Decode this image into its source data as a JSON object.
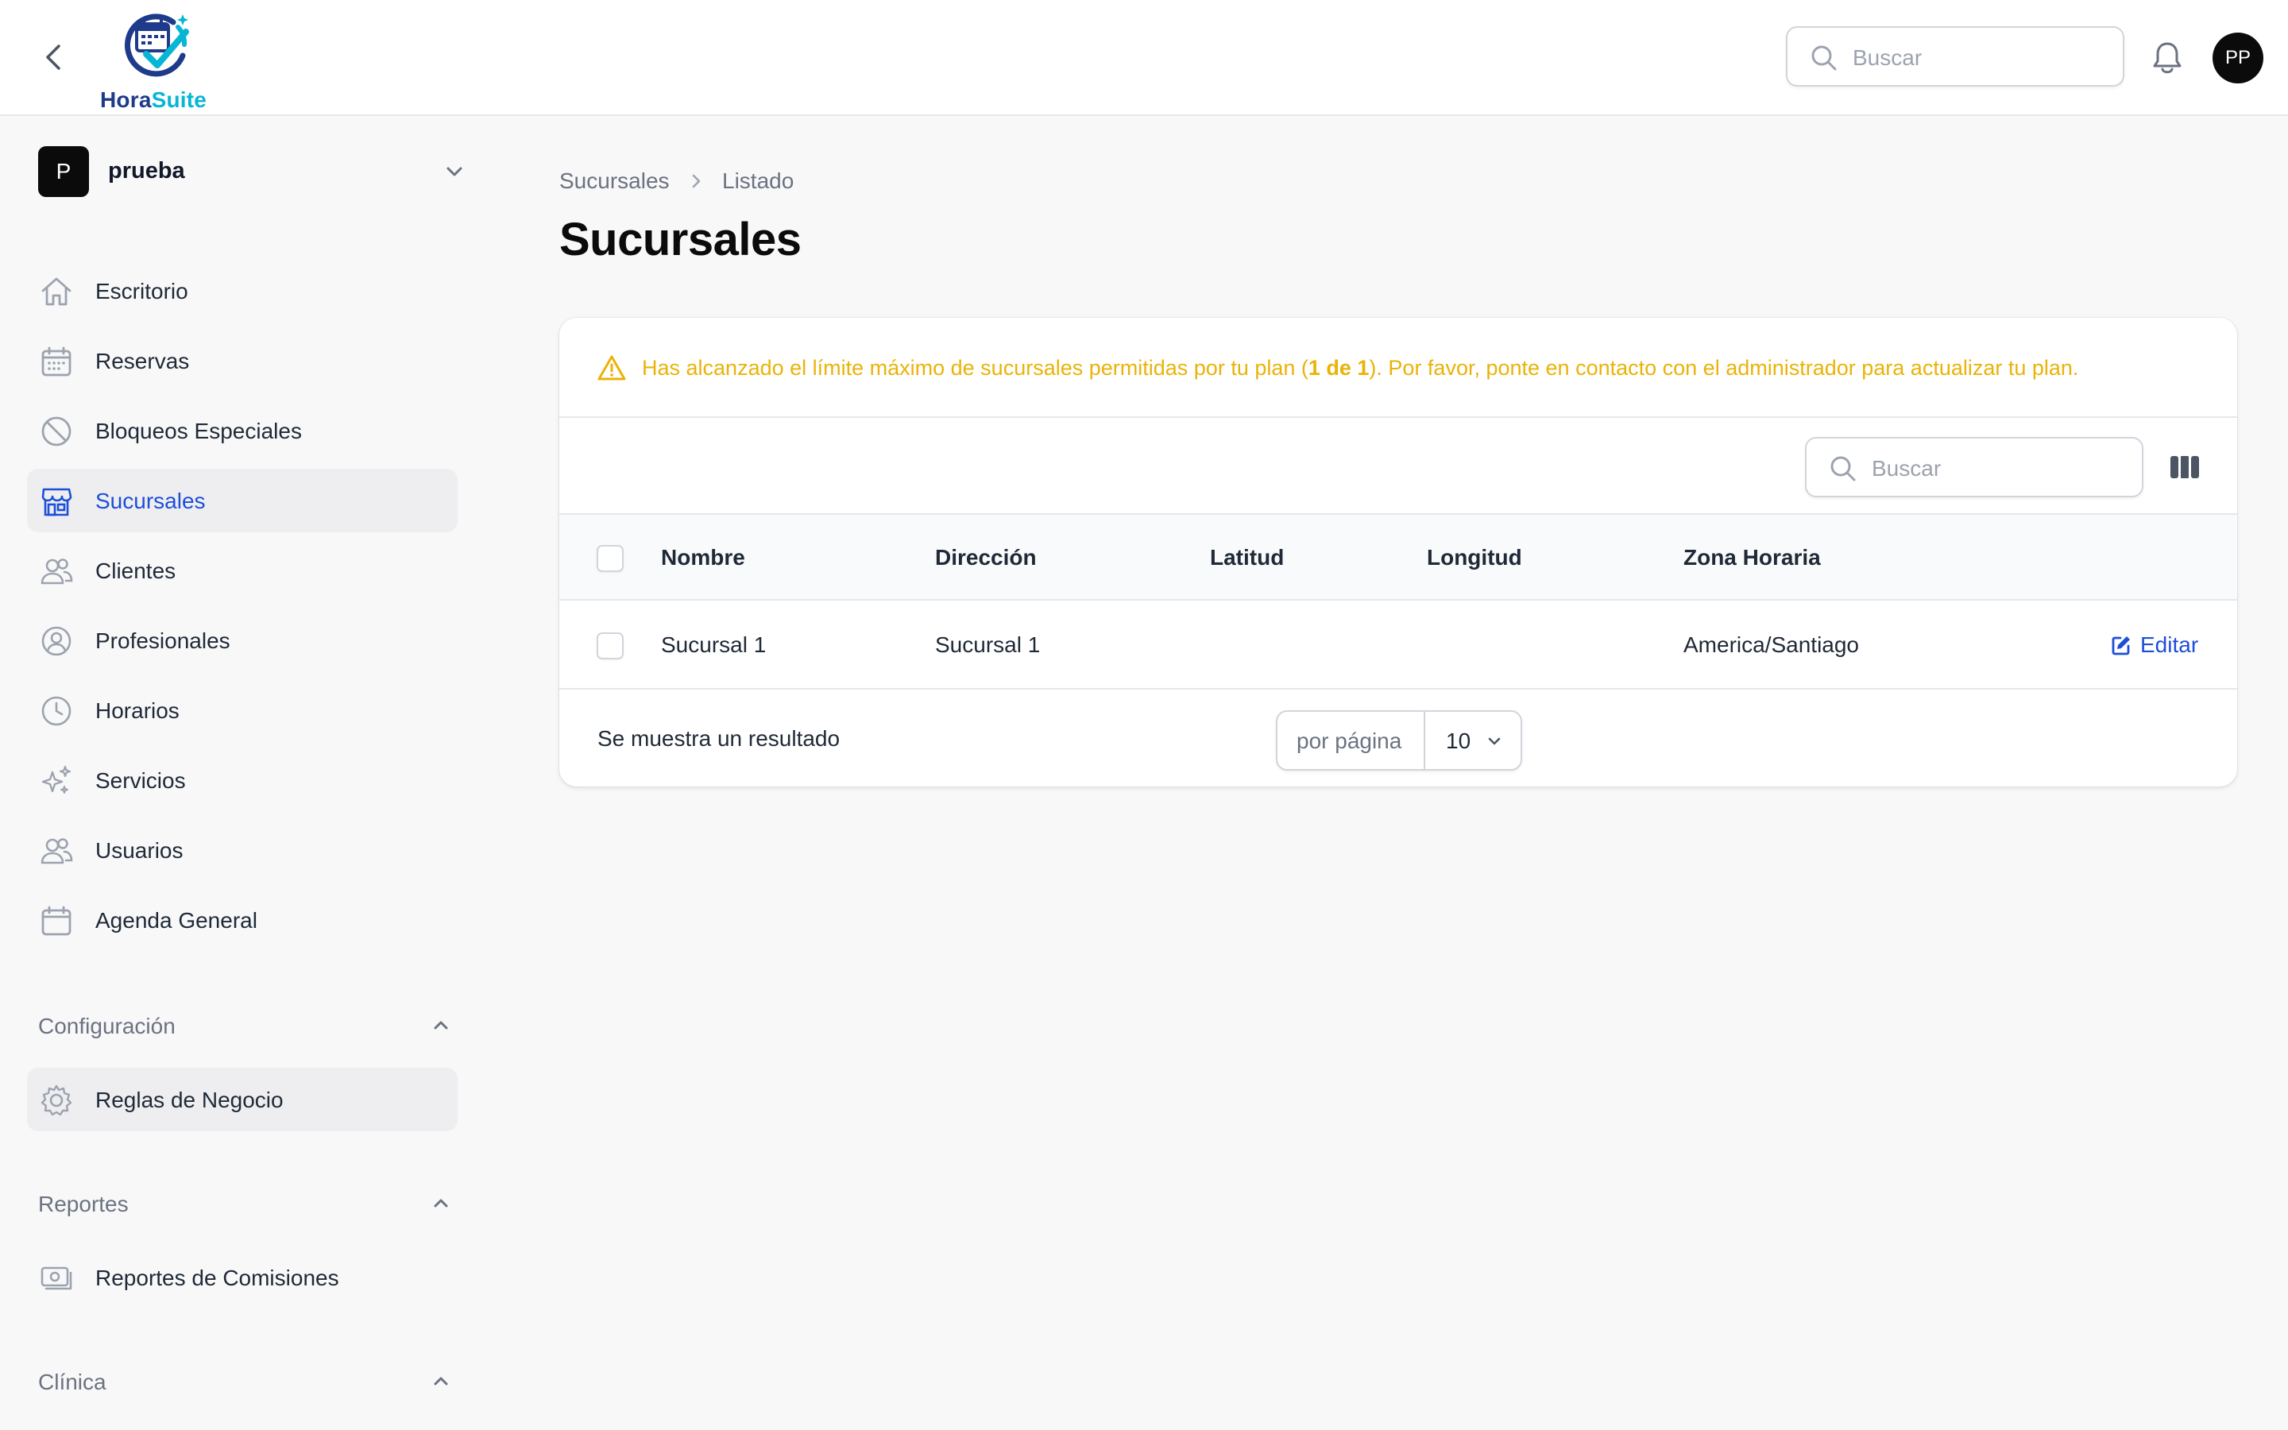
{
  "app": {
    "logo_text_a": "Hora",
    "logo_text_b": "Suite",
    "search_placeholder": "Buscar",
    "user_initials": "PP",
    "brand_colors": {
      "navy": "#1e3a8a",
      "cyan": "#06b6d4",
      "accent": "#1d4ed8",
      "warning": "#eab308"
    }
  },
  "tenant": {
    "initial": "P",
    "name": "prueba"
  },
  "sidebar": {
    "items": [
      {
        "label": "Escritorio",
        "icon": "home-icon"
      },
      {
        "label": "Reservas",
        "icon": "calendar-grid-icon"
      },
      {
        "label": "Bloqueos Especiales",
        "icon": "ban-icon"
      },
      {
        "label": "Sucursales",
        "icon": "storefront-icon",
        "active": true
      },
      {
        "label": "Clientes",
        "icon": "users-icon"
      },
      {
        "label": "Profesionales",
        "icon": "user-circle-icon"
      },
      {
        "label": "Horarios",
        "icon": "clock-icon"
      },
      {
        "label": "Servicios",
        "icon": "sparkles-icon"
      },
      {
        "label": "Usuarios",
        "icon": "users-icon"
      },
      {
        "label": "Agenda General",
        "icon": "calendar-icon"
      }
    ],
    "sections": [
      {
        "label": "Configuración",
        "items": [
          {
            "label": "Reglas de Negocio",
            "icon": "cog-icon"
          }
        ]
      },
      {
        "label": "Reportes",
        "items": [
          {
            "label": "Reportes de Comisiones",
            "icon": "cash-icon"
          }
        ]
      },
      {
        "label": "Clínica",
        "items": []
      }
    ]
  },
  "breadcrumb": {
    "parent": "Sucursales",
    "current": "Listado"
  },
  "page": {
    "title": "Sucursales"
  },
  "alert": {
    "text_before": "Has alcanzado el límite máximo de sucursales permitidas por tu plan (",
    "text_bold": "1 de 1",
    "text_after": "). Por favor, ponte en contacto con el administrador para actualizar tu plan."
  },
  "table": {
    "search_placeholder": "Buscar",
    "columns": [
      "Nombre",
      "Dirección",
      "Latitud",
      "Longitud",
      "Zona Horaria"
    ],
    "rows": [
      {
        "nombre": "Sucursal 1",
        "direccion": "Sucursal 1",
        "latitud": "",
        "longitud": "",
        "zona_horaria": "America/Santiago",
        "action": "Editar"
      }
    ],
    "result_text": "Se muestra un resultado",
    "per_page_label": "por página",
    "per_page_value": "10"
  }
}
